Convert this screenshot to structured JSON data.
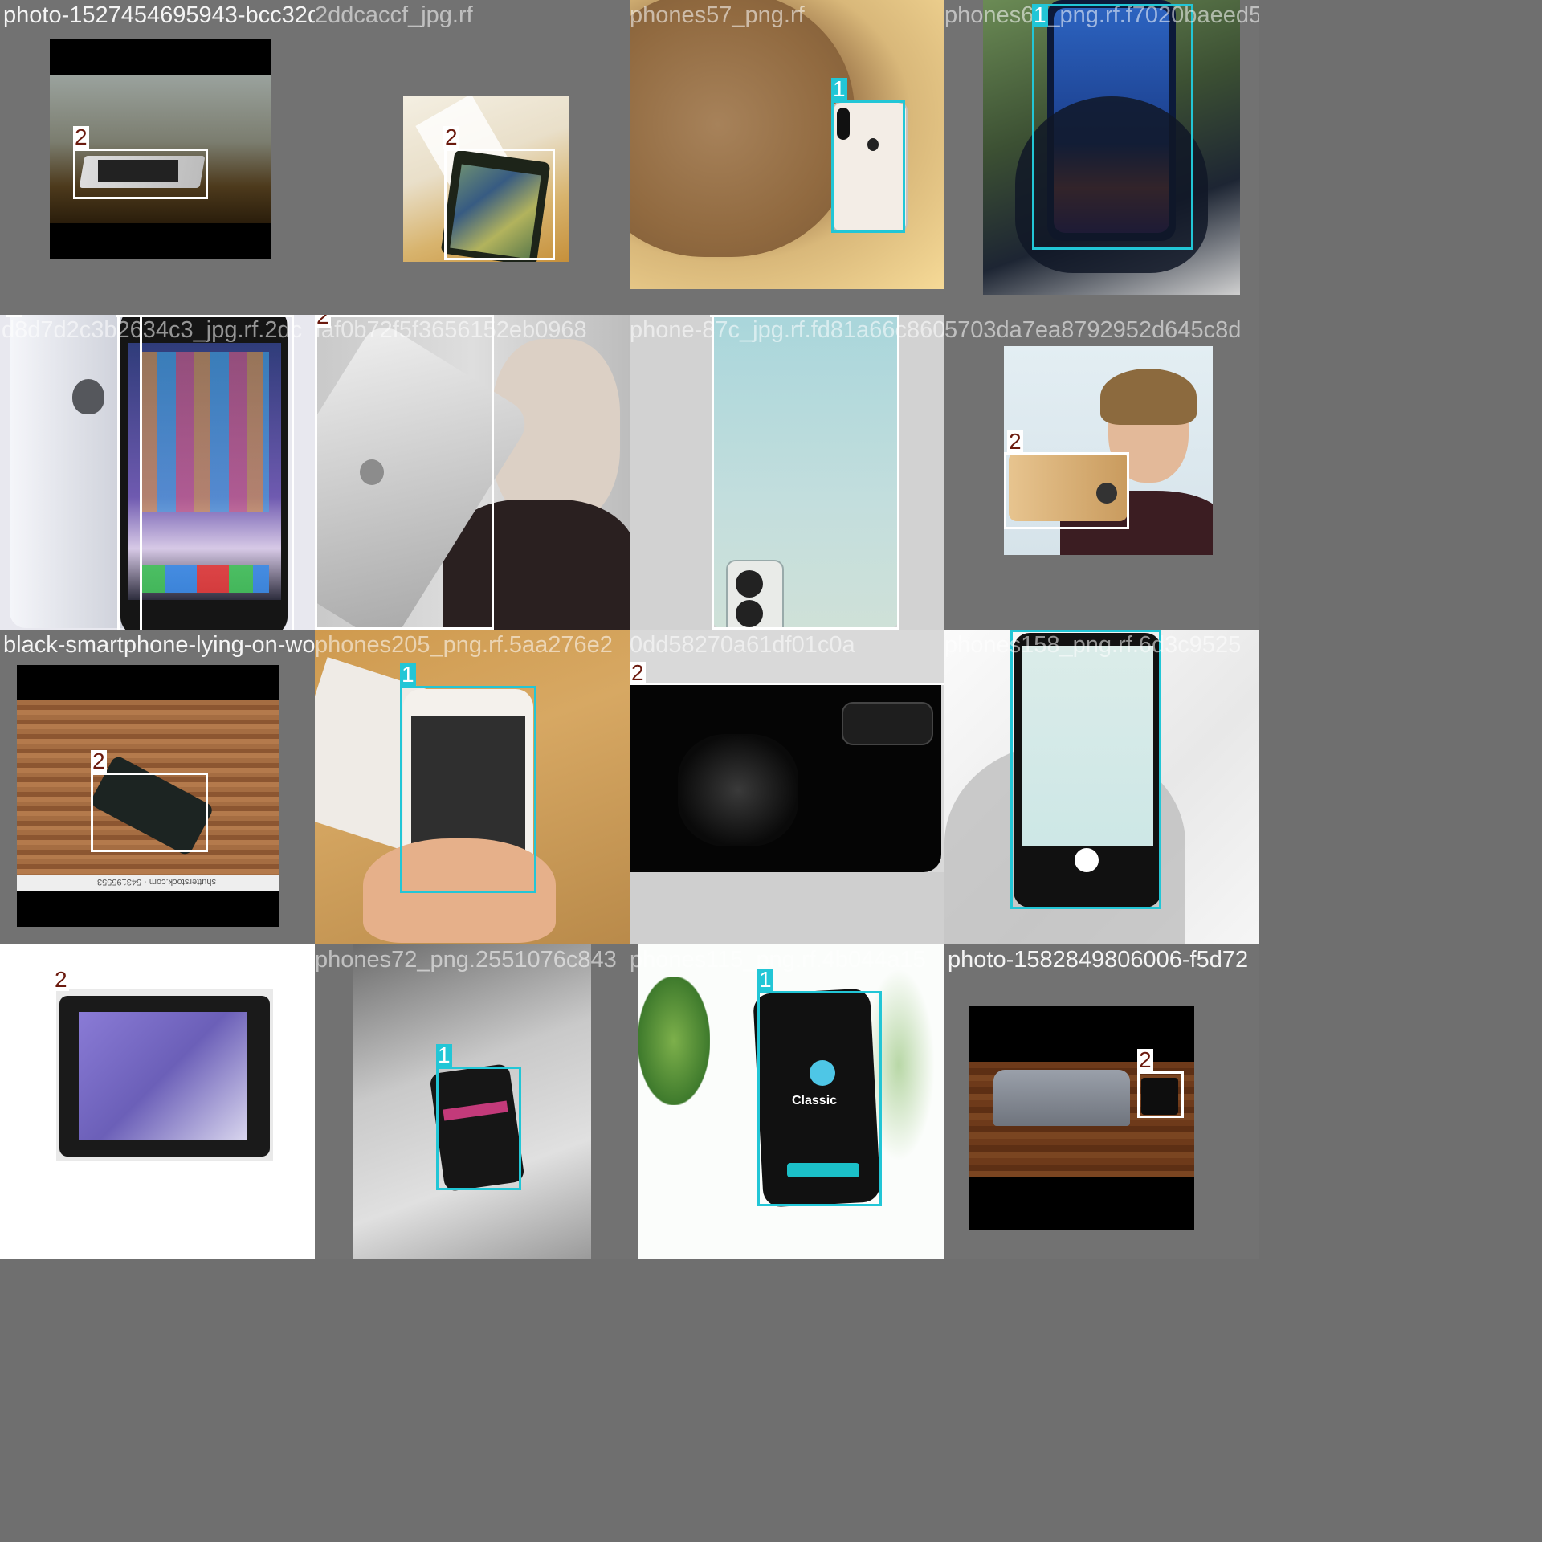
{
  "colors": {
    "class_1": "#22c6d6",
    "class_2": "#ffffff",
    "class_2_text": "#6b1a0e",
    "tile_background": "#727272"
  },
  "classes": {
    "c1": "1",
    "c2": "2"
  },
  "tiles": [
    {
      "filename": "photo-1527454695943-bcc32ddbcb1df6b4884d9_jpg.rf.ad82e55f787685.67a1c3ae1",
      "labels": [
        "2"
      ]
    },
    {
      "filename": "2ddcaccf_jpg.rf",
      "labels": [
        "2"
      ]
    },
    {
      "filename": "phones57_png.rf",
      "labels": [
        "1"
      ]
    },
    {
      "filename": "phones61_png.rf.f7020baeed5",
      "labels": [
        "1"
      ]
    },
    {
      "filename": "d8d7d2c3b2634c3_jpg.rf.2dc",
      "labels": [
        "2",
        "2"
      ]
    },
    {
      "filename": "faf0b72f5f3656152eb0968",
      "labels": [
        "2"
      ]
    },
    {
      "filename": "phone-87c_jpg.rf.fd81a66c860",
      "labels": [
        "2"
      ]
    },
    {
      "filename": "5703da7ea8792952d645c8d",
      "labels": [
        "2"
      ]
    },
    {
      "filename": "black-smartphone-lying-on-wooden-surface",
      "labels": [
        "2"
      ]
    },
    {
      "filename": "phones205_png.rf.5aa276e2",
      "labels": [
        "1"
      ]
    },
    {
      "filename": "0dd58270a61df01c0a",
      "labels": [
        "2"
      ]
    },
    {
      "filename": "phones158_png.rf.6d3c9525",
      "labels": [
        "1"
      ]
    },
    {
      "filename": "579460a70333707e_jpg.rf.7",
      "labels": [
        "2"
      ]
    },
    {
      "filename": "phones72_png.2551076c843",
      "labels": [
        "1"
      ]
    },
    {
      "filename": "phones115_png.rf.4b044a15",
      "labels": [
        "1"
      ]
    },
    {
      "filename": "photo-1582849806006-f5d72",
      "labels": [
        "2"
      ]
    }
  ],
  "overlay_text": {
    "tile4_extra_1": "1",
    "tile15_classic": "Classic",
    "tile7_watermark": "shutterstock.com · 543195553"
  }
}
